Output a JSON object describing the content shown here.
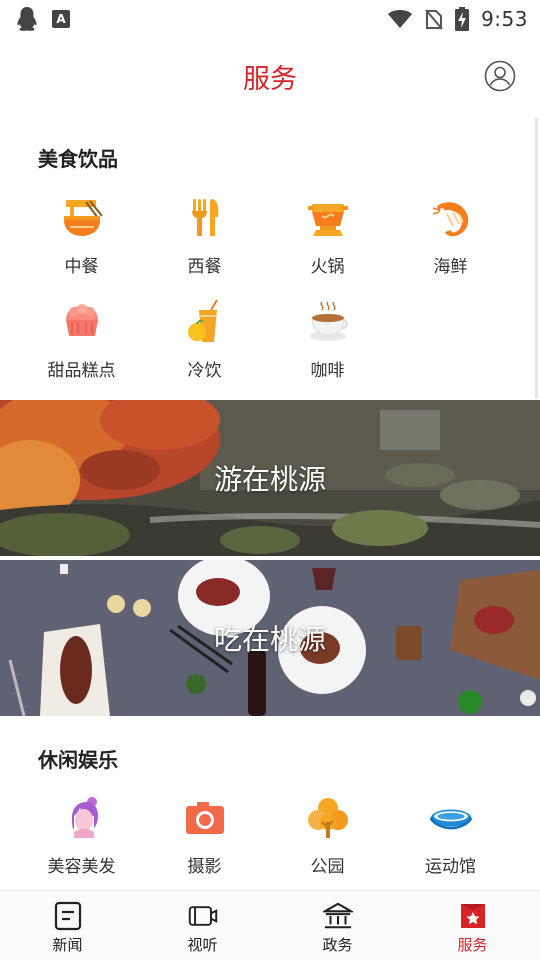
{
  "status_bar": {
    "time": "9:53"
  },
  "header": {
    "title": "服务"
  },
  "food_section": {
    "title": "美食饮品",
    "items": [
      {
        "label": "中餐",
        "icon": "noodle-bowl-icon"
      },
      {
        "label": "西餐",
        "icon": "fork-knife-icon"
      },
      {
        "label": "火锅",
        "icon": "hotpot-icon"
      },
      {
        "label": "海鲜",
        "icon": "shrimp-icon"
      },
      {
        "label": "甜品糕点",
        "icon": "cake-icon"
      },
      {
        "label": "冷饮",
        "icon": "cold-drink-icon"
      },
      {
        "label": "咖啡",
        "icon": "coffee-cup-icon"
      }
    ]
  },
  "banners": [
    {
      "label": "游在桃源"
    },
    {
      "label": "吃在桃源"
    }
  ],
  "leisure_section": {
    "title": "休闲娱乐",
    "items": [
      {
        "label": "美容美发",
        "icon": "beauty-salon-icon"
      },
      {
        "label": "摄影",
        "icon": "camera-icon"
      },
      {
        "label": "公园",
        "icon": "tree-icon"
      },
      {
        "label": "运动馆",
        "icon": "stadium-icon"
      }
    ]
  },
  "bottom_nav": {
    "items": [
      {
        "label": "新闻",
        "icon": "news-icon"
      },
      {
        "label": "视听",
        "icon": "video-camera-icon"
      },
      {
        "label": "政务",
        "icon": "government-building-icon"
      },
      {
        "label": "服务",
        "icon": "service-star-icon",
        "active": true
      }
    ]
  },
  "colors": {
    "accent": "#d8232a",
    "food_icon": "#f39a1e"
  }
}
